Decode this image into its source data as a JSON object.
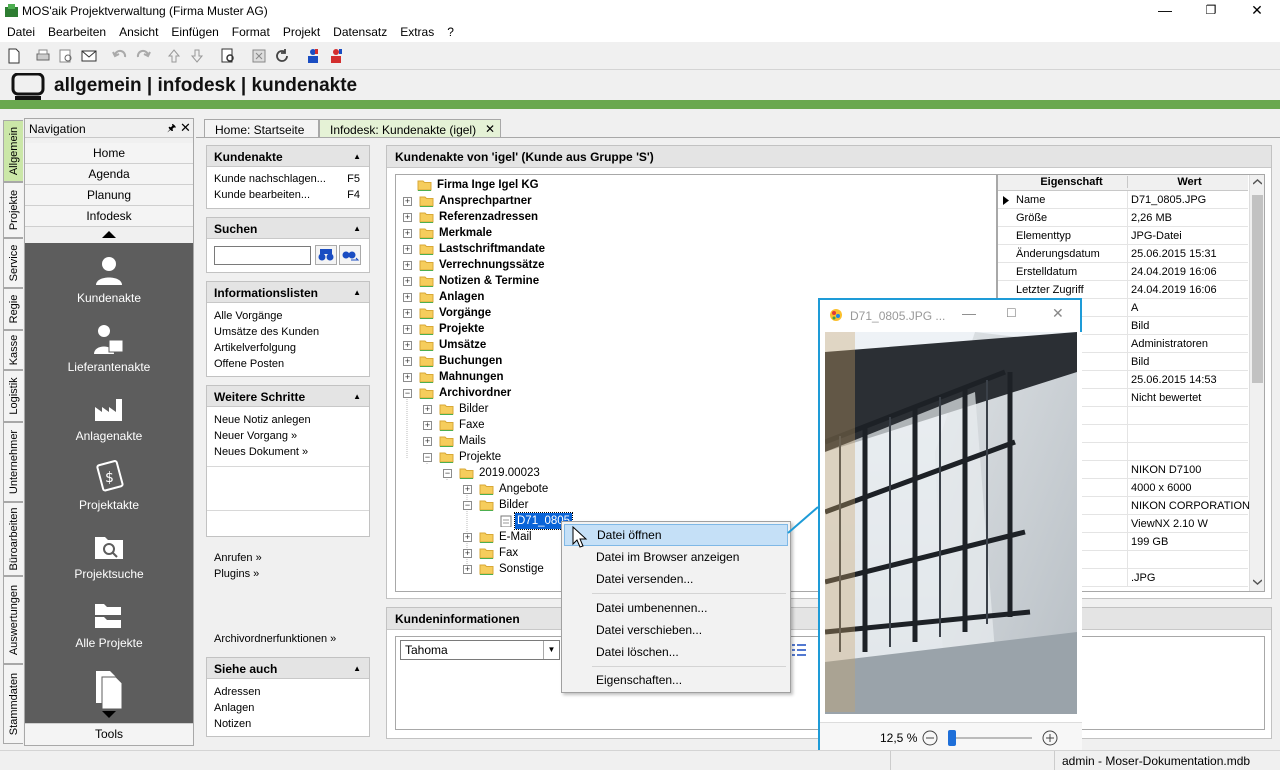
{
  "window": {
    "title": "MOS'aik Projektverwaltung (Firma Muster AG)",
    "minimize": "—",
    "maximize": "❐",
    "close": "✕"
  },
  "menu": [
    "Datei",
    "Bearbeiten",
    "Ansicht",
    "Einfügen",
    "Format",
    "Projekt",
    "Datensatz",
    "Extras",
    "?"
  ],
  "breadcrumb": "allgemein | infodesk | kundenakte",
  "colors": {
    "accent_green": "#6aa84f",
    "nav_dark": "#5d5d5d",
    "highlight_blue": "#1e9bd7"
  },
  "vtabs": [
    "Allgemein",
    "Projekte",
    "Service",
    "Regie",
    "Kasse",
    "Logistik",
    "Unternehmer",
    "Büroarbeiten",
    "Auswertungen",
    "Stammdaten"
  ],
  "navigation": {
    "title": "Navigation",
    "buttons": [
      "Home",
      "Agenda",
      "Planung",
      "Infodesk"
    ],
    "items": [
      "Kundenakte",
      "Lieferantenakte",
      "Anlagenakte",
      "Projektakte",
      "Projektsuche",
      "Alle Projekte"
    ],
    "footer": "Tools"
  },
  "tabs": [
    {
      "label": "Home: Startseite"
    },
    {
      "label": "Infodesk: Kundenakte (igel)"
    }
  ],
  "panels": {
    "kundenakte": {
      "title": "Kundenakte",
      "items": [
        {
          "label": "Kunde nachschlagen...",
          "key": "F5"
        },
        {
          "label": "Kunde bearbeiten...",
          "key": "F4"
        }
      ]
    },
    "suchen": {
      "title": "Suchen",
      "search_value": ""
    },
    "infolisten": {
      "title": "Informationslisten",
      "items": [
        "Alle Vorgänge",
        "Umsätze des Kunden",
        "Artikelverfolgung",
        "Offene Posten"
      ]
    },
    "weitere": {
      "title": "Weitere Schritte",
      "group1": [
        "Neue Notiz anlegen",
        "Neuer Vorgang »",
        "Neues Dokument »"
      ],
      "group2": [
        "Anrufen »",
        "Plugins »"
      ],
      "group3": [
        "Archivordnerfunktionen »"
      ]
    },
    "siehe": {
      "title": "Siehe auch",
      "items": [
        "Adressen",
        "Anlagen",
        "Notizen"
      ]
    }
  },
  "main": {
    "title": "Kundenakte von 'igel' (Kunde aus Gruppe 'S')",
    "tree": [
      {
        "label": "Firma Inge Igel KG",
        "level": 0,
        "bold": true,
        "pm": ""
      },
      {
        "label": "Ansprechpartner",
        "level": 1,
        "bold": true,
        "pm": "+"
      },
      {
        "label": "Referenzadressen",
        "level": 1,
        "bold": true,
        "pm": "+"
      },
      {
        "label": "Merkmale",
        "level": 1,
        "bold": true,
        "pm": "+"
      },
      {
        "label": "Lastschriftmandate",
        "level": 1,
        "bold": true,
        "pm": "+"
      },
      {
        "label": "Verrechnungssätze",
        "level": 1,
        "bold": true,
        "pm": "+"
      },
      {
        "label": "Notizen & Termine",
        "level": 1,
        "bold": true,
        "pm": "+"
      },
      {
        "label": "Anlagen",
        "level": 1,
        "bold": true,
        "pm": "+"
      },
      {
        "label": "Vorgänge",
        "level": 1,
        "bold": true,
        "pm": "+"
      },
      {
        "label": "Projekte",
        "level": 1,
        "bold": true,
        "pm": "+"
      },
      {
        "label": "Umsätze",
        "level": 1,
        "bold": true,
        "pm": "+"
      },
      {
        "label": "Buchungen",
        "level": 1,
        "bold": true,
        "pm": "+"
      },
      {
        "label": "Mahnungen",
        "level": 1,
        "bold": true,
        "pm": "+"
      },
      {
        "label": "Archivordner",
        "level": 1,
        "bold": true,
        "pm": "−"
      },
      {
        "label": "Bilder",
        "level": 2,
        "bold": false,
        "pm": "+"
      },
      {
        "label": "Faxe",
        "level": 2,
        "bold": false,
        "pm": "+"
      },
      {
        "label": "Mails",
        "level": 2,
        "bold": false,
        "pm": "+"
      },
      {
        "label": "Projekte",
        "level": 2,
        "bold": false,
        "pm": "−"
      },
      {
        "label": "2019.00023",
        "level": 3,
        "bold": false,
        "pm": "−"
      },
      {
        "label": "Angebote",
        "level": 4,
        "bold": false,
        "pm": "+"
      },
      {
        "label": "Bilder",
        "level": 4,
        "bold": false,
        "pm": "−"
      },
      {
        "label": "D71_0805",
        "level": 5,
        "bold": false,
        "pm": "",
        "file": true
      },
      {
        "label": "E-Mail",
        "level": 4,
        "bold": false,
        "pm": "+"
      },
      {
        "label": "Fax",
        "level": 4,
        "bold": false,
        "pm": "+"
      },
      {
        "label": "Sonstige",
        "level": 4,
        "bold": false,
        "pm": "+"
      }
    ],
    "props_header": {
      "key": "Eigenschaft",
      "value": "Wert"
    },
    "props": [
      {
        "k": "Name",
        "v": "D71_0805.JPG"
      },
      {
        "k": "Größe",
        "v": "2,26 MB"
      },
      {
        "k": "Elementtyp",
        "v": "JPG-Datei"
      },
      {
        "k": "Änderungsdatum",
        "v": "25.06.2015 15:31"
      },
      {
        "k": "Erstelldatum",
        "v": "24.04.2019 16:06"
      },
      {
        "k": "Letzter Zugriff",
        "v": "24.04.2019 16:06"
      },
      {
        "k": "",
        "v": "A"
      },
      {
        "k": "",
        "v": "Bild"
      },
      {
        "k": "",
        "v": "Administratoren"
      },
      {
        "k": "",
        "v": "Bild"
      },
      {
        "k": "um",
        "v": "25.06.2015 14:53"
      },
      {
        "k": "",
        "v": "Nicht bewertet"
      },
      {
        "k": "",
        "v": ""
      },
      {
        "k": "e",
        "v": ""
      },
      {
        "k": "",
        "v": ""
      },
      {
        "k": "",
        "v": "NIKON D7100"
      },
      {
        "k": "",
        "v": "4000 x 6000"
      },
      {
        "k": "ller",
        "v": "NIKON CORPORATION"
      },
      {
        "k": "e",
        "v": "ViewNX 2.10 W"
      },
      {
        "k": "",
        "v": "199 GB"
      },
      {
        "k": "",
        "v": ""
      },
      {
        "k": "ung",
        "v": ".JPG"
      }
    ]
  },
  "kinfo": {
    "title": "Kundeninformationen",
    "font": "Tahoma"
  },
  "context_menu": {
    "items": [
      "Datei öffnen",
      "Datei im Browser anzeigen",
      "Datei versenden...",
      "Datei umbenennen...",
      "Datei verschieben...",
      "Datei löschen...",
      "Eigenschaften..."
    ]
  },
  "viewer": {
    "title": "D71_0805.JPG ...",
    "zoom": "12,5 %",
    "zoom_fraction": 0.0
  },
  "status": {
    "text": "admin - Moser-Dokumentation.mdb"
  }
}
